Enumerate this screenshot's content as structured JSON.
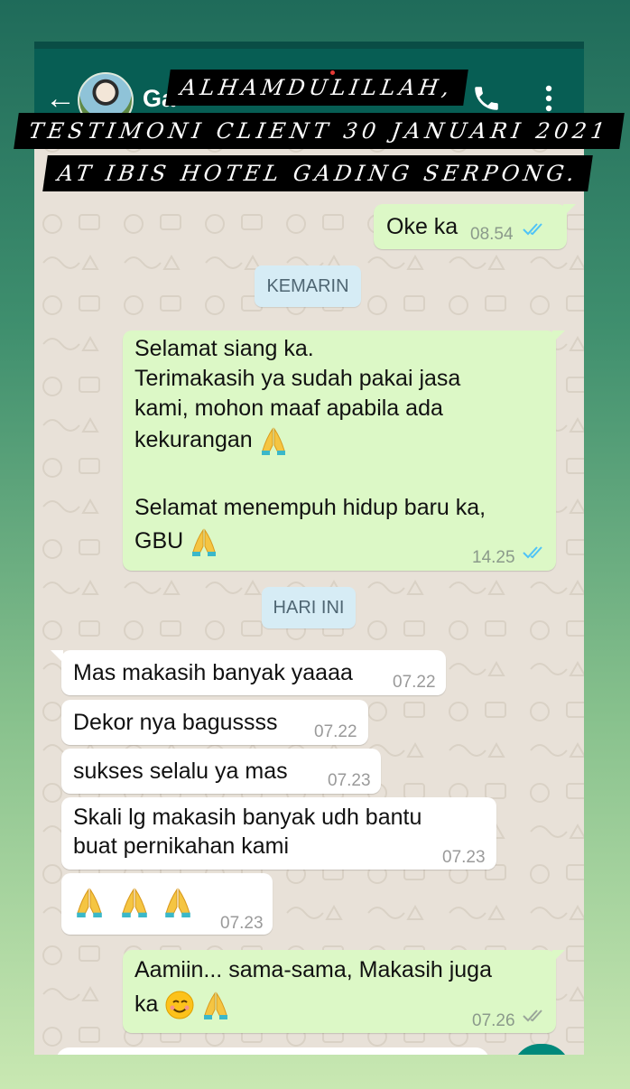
{
  "caption": {
    "line1": "ALHAMDULILLAH,",
    "line2": "TESTIMONI CLIENT 30 JANUARI 2021",
    "line3": "AT IBIS HOTEL GADING SERPONG."
  },
  "header": {
    "contact_name": "Ga",
    "icons": [
      "back-arrow-icon",
      "avatar",
      "call-icon",
      "menu-icon"
    ]
  },
  "messages": {
    "m1": {
      "text": "Oke ka",
      "time": "08.54"
    },
    "chip1": "KEMARIN",
    "m2": {
      "line1": "Selamat siang ka.",
      "line2": "Terimakasih ya sudah pakai jasa",
      "line3": "kami, mohon maaf apabila ada",
      "line4": "kekurangan",
      "line5": "Selamat menempuh hidup baru ka,",
      "line6": "GBU",
      "time": "14.25"
    },
    "chip2": "HARI INI",
    "m3": {
      "text": "Mas makasih banyak yaaaa",
      "time": "07.22"
    },
    "m4": {
      "text": "Dekor nya bagussss",
      "time": "07.22"
    },
    "m5": {
      "text": "sukses selalu ya mas",
      "time": "07.23"
    },
    "m6": {
      "line1": "Skali lg makasih banyak udh bantu",
      "line2": "buat pernikahan kami",
      "time": "07.23"
    },
    "m7": {
      "time": "07.23"
    },
    "m8": {
      "line1": "Aamiin... sama-sama, Makasih juga",
      "line2": "ka",
      "time": "07.26"
    }
  },
  "colors": {
    "appbar": "#075e54",
    "outgoing_bubble": "#dcf8c6",
    "incoming_bubble": "#ffffff",
    "read_ticks": "#4fc3f7",
    "date_chip": "#d6ecf5"
  }
}
